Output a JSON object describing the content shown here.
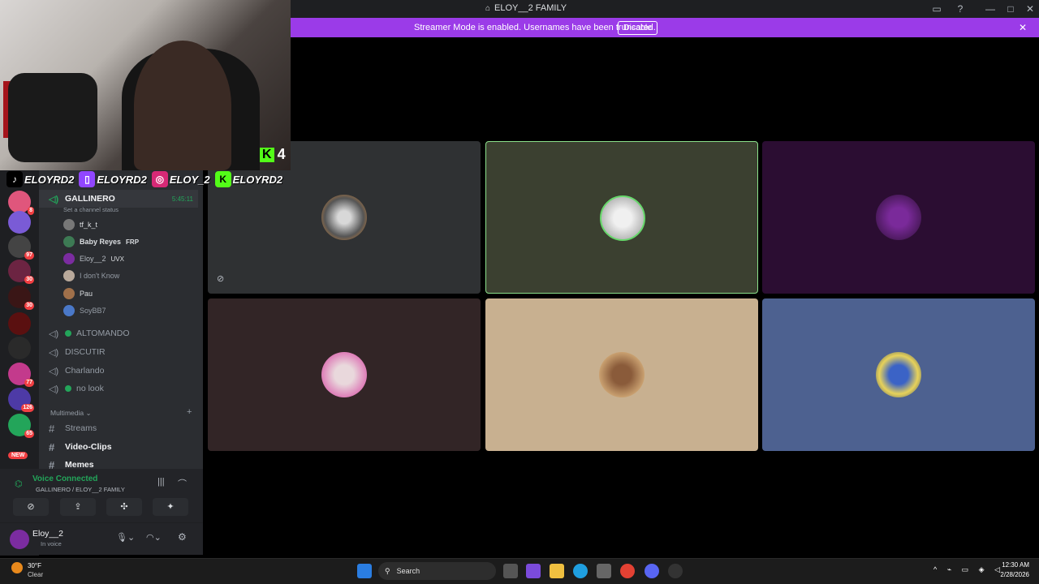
{
  "window": {
    "title": "ELOY__2 FAMILY"
  },
  "banner": {
    "text": "Streamer Mode is enabled. Usernames have been truncated.",
    "button": "Disable"
  },
  "overlay": {
    "viewer_count": "4",
    "socials": [
      "ELOYRD2",
      "ELOYRD2",
      "ELOY_2",
      "ELOYRD2"
    ]
  },
  "server_badges": [
    "8",
    "97",
    "30",
    "30",
    "77",
    "126",
    "65"
  ],
  "new_badge": "NEW",
  "active_channel": {
    "name": "GALLINERO",
    "timer": "5:45:11",
    "status_placeholder": "Set a channel status",
    "members": [
      {
        "name": "tf_k_t",
        "tag": ""
      },
      {
        "name": "Baby Reyes",
        "tag": "FRP"
      },
      {
        "name": "Eloy__2",
        "tag": "UVX"
      },
      {
        "name": "I don't Know",
        "tag": ""
      },
      {
        "name": "Pau",
        "tag": ""
      },
      {
        "name": "SoyBB7",
        "tag": ""
      }
    ]
  },
  "voice_channels": [
    "ALTOMANDO",
    "DISCUTIR",
    "Charlando",
    "no look"
  ],
  "category": "Multimedia",
  "text_channels": [
    "Streams",
    "Video-Clips",
    "Memes"
  ],
  "voice_status": {
    "label": "Voice Connected",
    "location": "GALLINERO / ELOY__2 FAMILY"
  },
  "user": {
    "name": "Eloy__2",
    "status": "In voice"
  },
  "taskbar": {
    "weather_temp": "30°F",
    "weather_desc": "Clear",
    "search_placeholder": "Search",
    "time": "12:30 AM",
    "date": "2/28/2026"
  }
}
